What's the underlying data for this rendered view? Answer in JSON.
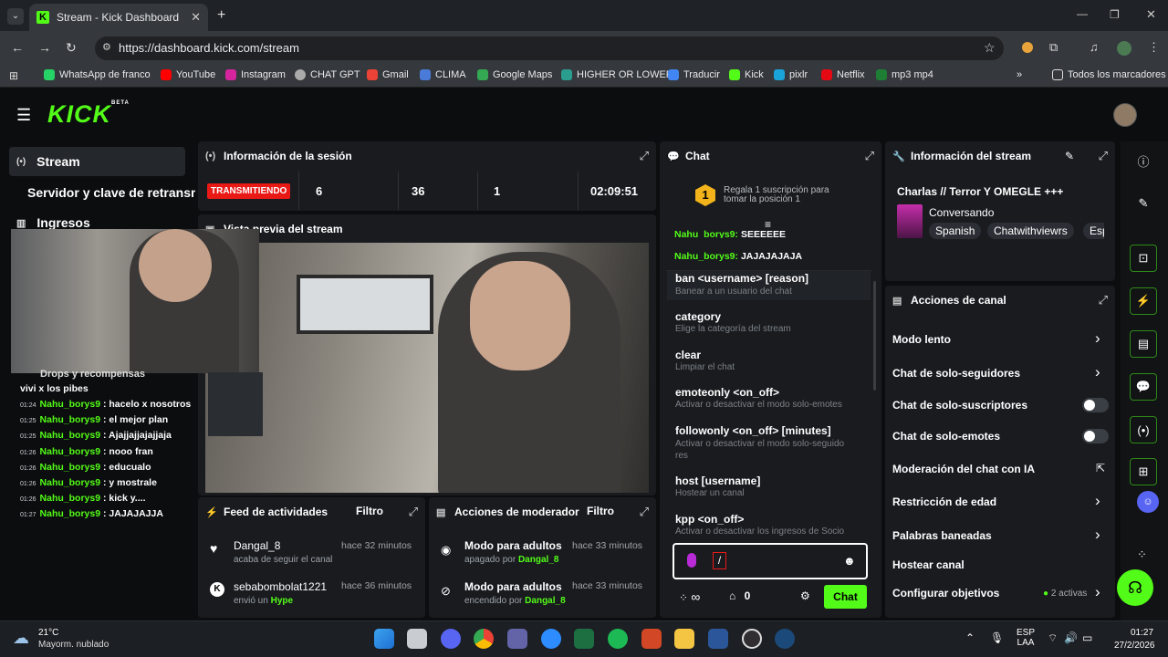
{
  "browser": {
    "tab_title": "Stream - Kick Dashboard",
    "url": "https://dashboard.kick.com/stream",
    "bookmarks": [
      "WhatsApp de franco",
      "YouTube",
      "Instagram",
      "CHAT GPT",
      "Gmail",
      "CLIMA",
      "Google Maps",
      "HIGHER OR LOWER",
      "Traducir",
      "Kick",
      "pixlr",
      "Netflix",
      "mp3 mp4"
    ],
    "all_bookmarks": "Todos los marcadores",
    "more": "»"
  },
  "header": {
    "logo": "KICK",
    "beta": "BETA"
  },
  "sidebar": {
    "items": [
      {
        "label": "Stream"
      },
      {
        "label": "Servidor y clave de retransm"
      },
      {
        "label": "Ingresos"
      }
    ],
    "drops": "Drops y recompensas"
  },
  "session": {
    "title": "Información de la sesión",
    "status": "TRANSMITIENDO",
    "viewers": "6",
    "followers": "36",
    "subs": "1",
    "duration": "02:09:51"
  },
  "preview": {
    "title": "Vista previa del stream"
  },
  "overlay_chat": [
    {
      "time": "",
      "user": "",
      "msg": "vivi x los pibes"
    },
    {
      "time": "01:24",
      "user": "Nahu_borys9",
      "msg": ": hacelo x nosotros"
    },
    {
      "time": "01:25",
      "user": "Nahu_borys9",
      "msg": ": el mejor plan"
    },
    {
      "time": "01:25",
      "user": "Nahu_borys9",
      "msg": ": Ajajjajjajajjaja"
    },
    {
      "time": "01:26",
      "user": "Nahu_borys9",
      "msg": ": nooo fran"
    },
    {
      "time": "01:26",
      "user": "Nahu_borys9",
      "msg": ": educualo"
    },
    {
      "time": "01:26",
      "user": "Nahu_borys9",
      "msg": ": y mostrale"
    },
    {
      "time": "01:26",
      "user": "Nahu_borys9",
      "msg": ": kick y...."
    },
    {
      "time": "01:27",
      "user": "Nahu_borys9",
      "msg": ": JAJAJAJJA"
    }
  ],
  "feed": {
    "title": "Feed de actividades",
    "filter": "Filtro",
    "items": [
      {
        "user": "Dangal_8",
        "time": "hace 32 minutos",
        "desc": "acaba de seguir el canal"
      },
      {
        "user": "sebabombolat1221",
        "time": "hace 36 minutos",
        "desc": "envió un",
        "extra": "Hype"
      }
    ]
  },
  "mod": {
    "title": "Acciones de moderador",
    "filter": "Filtro",
    "items": [
      {
        "title": "Modo para adultos",
        "time": "hace 33 minutos",
        "desc": "apagado por",
        "user": "Dangal_8"
      },
      {
        "title": "Modo para adultos",
        "time": "hace 33 minutos",
        "desc": "encendido por",
        "user": "Dangal_8"
      }
    ]
  },
  "chat": {
    "title": "Chat",
    "gift": "Regala 1 suscripción para tomar la posición 1",
    "gift_rank": "1",
    "messages": [
      {
        "user": "Nahu_borys9:",
        "msg": "SEEEEEE"
      },
      {
        "user": "Nahu_borys9:",
        "msg": "JAJAJAJAJA"
      }
    ],
    "commands": [
      {
        "cmd": "ban <username> [reason]",
        "desc": "Banear a un usuario del chat"
      },
      {
        "cmd": "category",
        "desc": "Elige la categoría del stream"
      },
      {
        "cmd": "clear",
        "desc": "Limpiar el chat"
      },
      {
        "cmd": "emoteonly <on_off>",
        "desc": "Activar o desactivar el modo solo-emotes"
      },
      {
        "cmd": "followonly <on_off> [minutes]",
        "desc": "Activar o desactivar el modo solo-seguido",
        "desc2": "res"
      },
      {
        "cmd": "host [username]",
        "desc": "Hostear un canal"
      },
      {
        "cmd": "kpp <on_off>",
        "desc": "Activar o desactivar los ingresos de Socio"
      }
    ],
    "input_value": "/",
    "points": "∞",
    "count": "0",
    "send": "Chat"
  },
  "stream_info": {
    "title": "Información del stream",
    "stream_title": "Charlas // Terror Y OMEGLE +++",
    "category": "Conversando",
    "tags": [
      "Spanish",
      "Chatwithviewrs",
      "Esp"
    ]
  },
  "channel_actions": {
    "title": "Acciones de canal",
    "items": [
      {
        "label": "Modo lento"
      },
      {
        "label": "Chat de solo-seguidores"
      },
      {
        "label": "Chat de solo-suscriptores"
      },
      {
        "label": "Chat de solo-emotes"
      },
      {
        "label": "Moderación del chat con IA"
      },
      {
        "label": "Restricción de edad"
      },
      {
        "label": "Palabras baneadas"
      },
      {
        "label": "Hostear canal"
      },
      {
        "label": "Configurar objetivos"
      }
    ],
    "goals_badge": "2 activas"
  },
  "taskbar": {
    "temp": "21°C",
    "weather": "Mayorm. nublado",
    "lang1": "ESP",
    "lang2": "LAA",
    "time": "01:27",
    "date": "27/2/2026"
  },
  "colors": {
    "brand": "#53fc18",
    "live": "#e91916",
    "panel": "#191b1f"
  }
}
